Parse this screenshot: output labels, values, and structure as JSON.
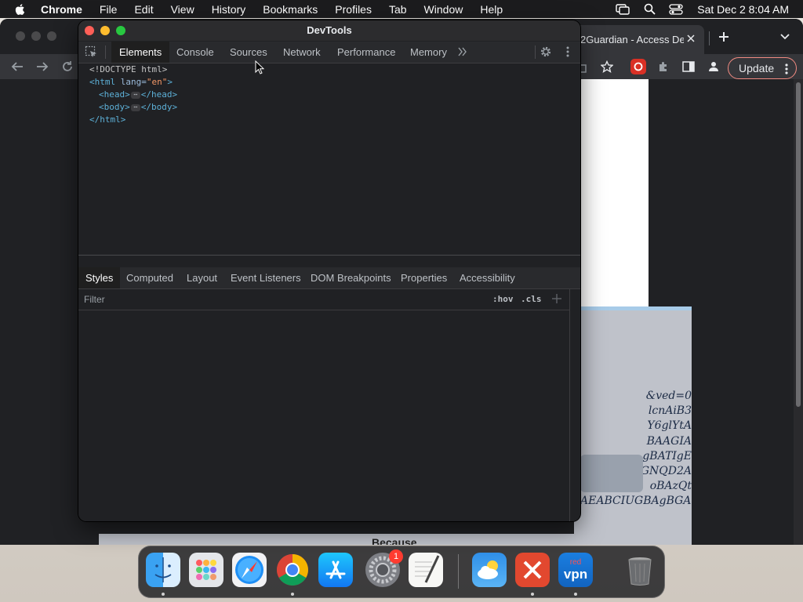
{
  "menubar": {
    "app": "Chrome",
    "items": [
      "File",
      "Edit",
      "View",
      "History",
      "Bookmarks",
      "Profiles",
      "Tab",
      "Window",
      "Help"
    ],
    "clock": "Sat Dec 2  8:04 AM"
  },
  "browser": {
    "tab_title": "2Guardian - Access De",
    "update_label": "Update",
    "page_code_lines": [
      "&ved=0",
      "lcnAiB3",
      "Y6glYtA",
      "BAAGIA",
      "gBATIgE",
      "GNQD2A",
      "oBAzQt",
      "AEABCIUGBAgBGAc"
    ],
    "page_word": "Because"
  },
  "devtools": {
    "title": "DevTools",
    "main_tabs": [
      "Elements",
      "Console",
      "Sources",
      "Network",
      "Performance",
      "Memory"
    ],
    "dom": {
      "doctype": "<!DOCTYPE html>",
      "html_open_tag": "<html",
      "html_attr": "lang=",
      "html_attr_val": "\"en\"",
      "html_open_close": ">",
      "head_open": "<head>",
      "head_close": "</head>",
      "body_open": "<body>",
      "body_close": "</body>",
      "html_close": "</html>",
      "ellipsis": "⋯"
    },
    "sub_tabs": [
      "Styles",
      "Computed",
      "Layout",
      "Event Listeners",
      "DOM Breakpoints",
      "Properties",
      "Accessibility"
    ],
    "filter_placeholder": "Filter",
    "hov_label": ":hov",
    "cls_label": ".cls"
  },
  "dock": {
    "apps": [
      "Finder",
      "Launchpad",
      "Safari",
      "Google Chrome",
      "App Store",
      "System Settings",
      "TextEdit",
      "Weather",
      "Remote Desktop",
      "Red VPN",
      "Trash"
    ],
    "settings_badge": "1",
    "vpn_label_top": "red",
    "vpn_label": "vpn"
  }
}
